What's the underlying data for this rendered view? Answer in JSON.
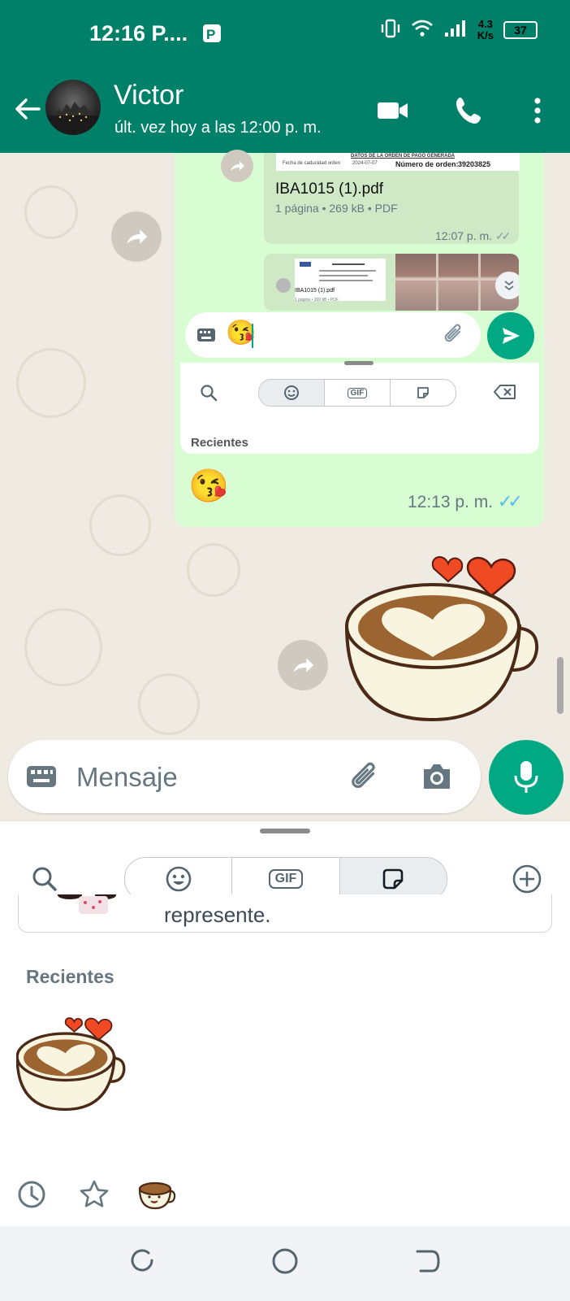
{
  "status_bar": {
    "time": "12:16 P....",
    "network_speed_top": "4.3",
    "network_speed_bottom": "K/s",
    "battery": "37"
  },
  "header": {
    "contact_name": "Victor",
    "last_seen": "últ. vez hoy a las 12:00 p. m."
  },
  "forwarded_message": {
    "doc_heading": "DATOS DE LA ORDEN DE PAGO GENERADA",
    "doc_date_label": "Fecha de caducidad orden",
    "doc_date_value": "2024-07-07",
    "doc_order_label": "Número de orden:",
    "doc_order_value": "39203825",
    "doc_name": "IBA1015 (1).pdf",
    "doc_meta": "1 página • 269 kB • PDF",
    "doc_time": "12:07 p. m.",
    "media_caption": "IBA1015 (1).pdf",
    "media_meta": "1 página • 269 kB • PDF",
    "inner_input_emoji": "😘",
    "inner_recientes": "Recientes",
    "inner_gif": "GIF",
    "bubble_emoji": "😘",
    "bubble_time": "12:13 p. m."
  },
  "composer": {
    "placeholder": "Mensaje"
  },
  "sticker_panel": {
    "gif_tab": "GIF",
    "peek_text": "represente.",
    "recientes": "Recientes"
  }
}
